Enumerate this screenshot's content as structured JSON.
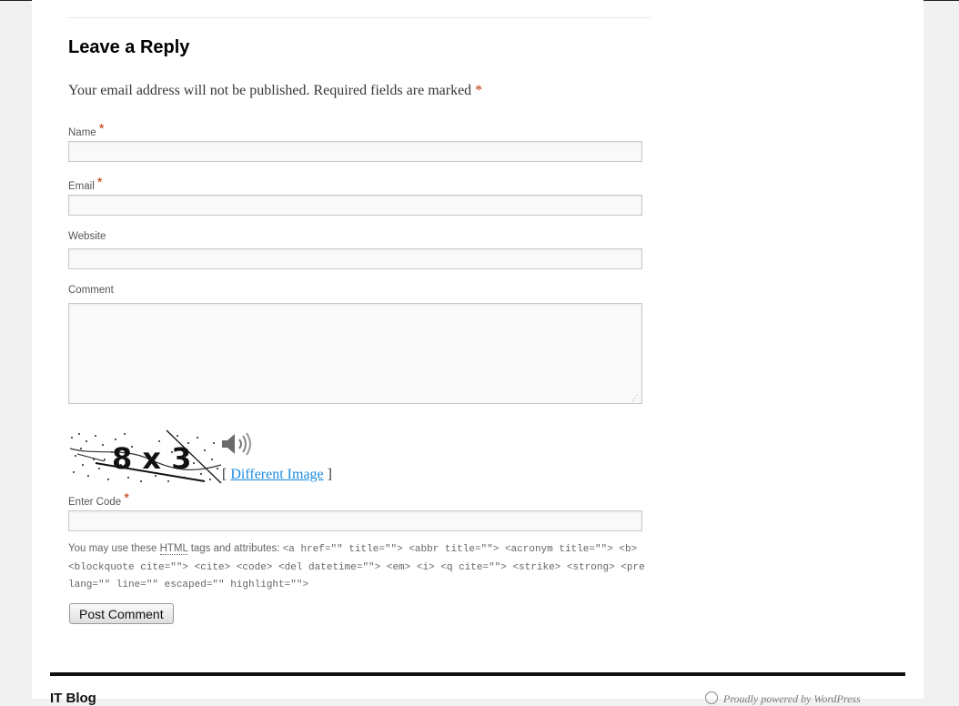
{
  "reply": {
    "title": "Leave a Reply",
    "notes": "Your email address will not be published. Required fields are marked",
    "required_mark": "*"
  },
  "form": {
    "name_label": "Name",
    "email_label": "Email",
    "website_label": "Website",
    "comment_label": "Comment",
    "name_value": "",
    "email_value": "",
    "website_value": "",
    "comment_value": "",
    "enter_code_label": "Enter Code",
    "code_value": "",
    "submit_label": "Post Comment"
  },
  "captcha": {
    "text": "8 x 3",
    "different_image_prefix": "[",
    "different_image_label": "Different Image",
    "different_image_suffix": "]",
    "audio_icon": "speaker-icon"
  },
  "allowed_tags": {
    "prefix": "You may use these",
    "abbr": "HTML",
    "middle": "tags and attributes:",
    "code": "<a href=\"\" title=\"\"> <abbr title=\"\"> <acronym title=\"\"> <b> <blockquote cite=\"\"> <cite> <code> <del datetime=\"\"> <em> <i> <q cite=\"\"> <strike> <strong> <pre lang=\"\" line=\"\" escaped=\"\" highlight=\"\">"
  },
  "footer": {
    "site_title": "IT Blog",
    "powered": "Proudly powered by WordPress"
  },
  "colors": {
    "required": "#bd3500",
    "link": "#1b8be0"
  }
}
